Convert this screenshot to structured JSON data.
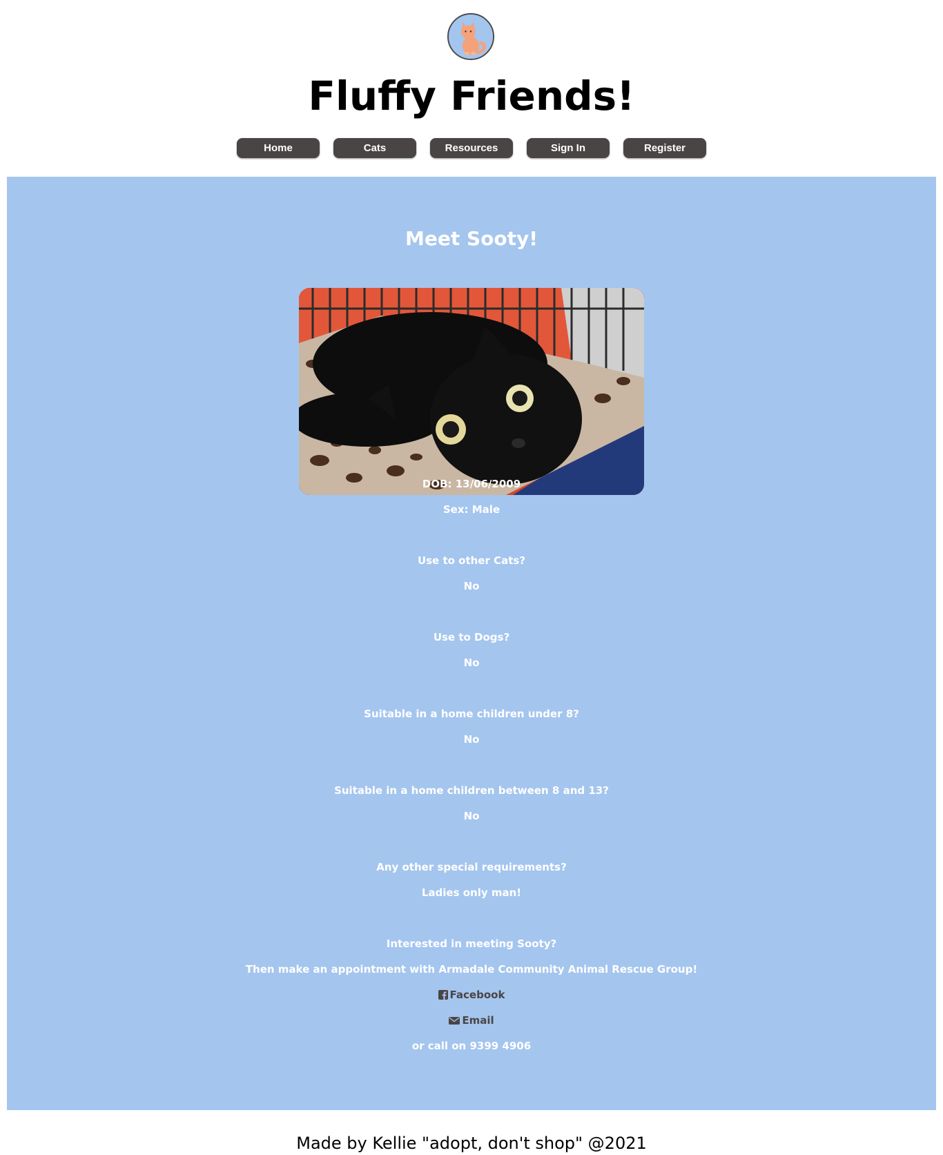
{
  "header": {
    "logo_icon": "orange-cat-icon",
    "title": "Fluffy Friends!"
  },
  "nav": {
    "items": [
      {
        "label": "Home"
      },
      {
        "label": "Cats"
      },
      {
        "label": "Resources"
      },
      {
        "label": "Sign In"
      },
      {
        "label": "Register"
      }
    ]
  },
  "profile": {
    "title": "Meet Sooty!",
    "photo_icon": "black-cat-photo",
    "dob": "DOB: 13/06/2009",
    "sex": "Sex: Male",
    "other_cats_q": "Use to other Cats?",
    "other_cats_a": "No",
    "dogs_q": "Use to Dogs?",
    "dogs_a": "No",
    "kids_under8_q": "Suitable in a home children under 8?",
    "kids_under8_a": "No",
    "kids_8to13_q": "Suitable in a home children between 8 and 13?",
    "kids_8to13_a": "No",
    "special_q": "Any other special requirements?",
    "special_a": "Ladies only man!",
    "interested": "Interested in meeting Sooty?",
    "appointment": "Then make an appointment with Armadale Community Animal Rescue Group!",
    "facebook_label": "Facebook",
    "facebook_icon": "facebook-icon",
    "email_label": "Email",
    "email_icon": "envelope-icon",
    "phone": "or call on 9399 4906"
  },
  "footer": {
    "text": "Made by Kellie \"adopt, don't shop\" @2021"
  },
  "colors": {
    "accent_bg": "#a4c5ee",
    "nav_button": "#4a4545",
    "text_light": "#ffffff"
  }
}
